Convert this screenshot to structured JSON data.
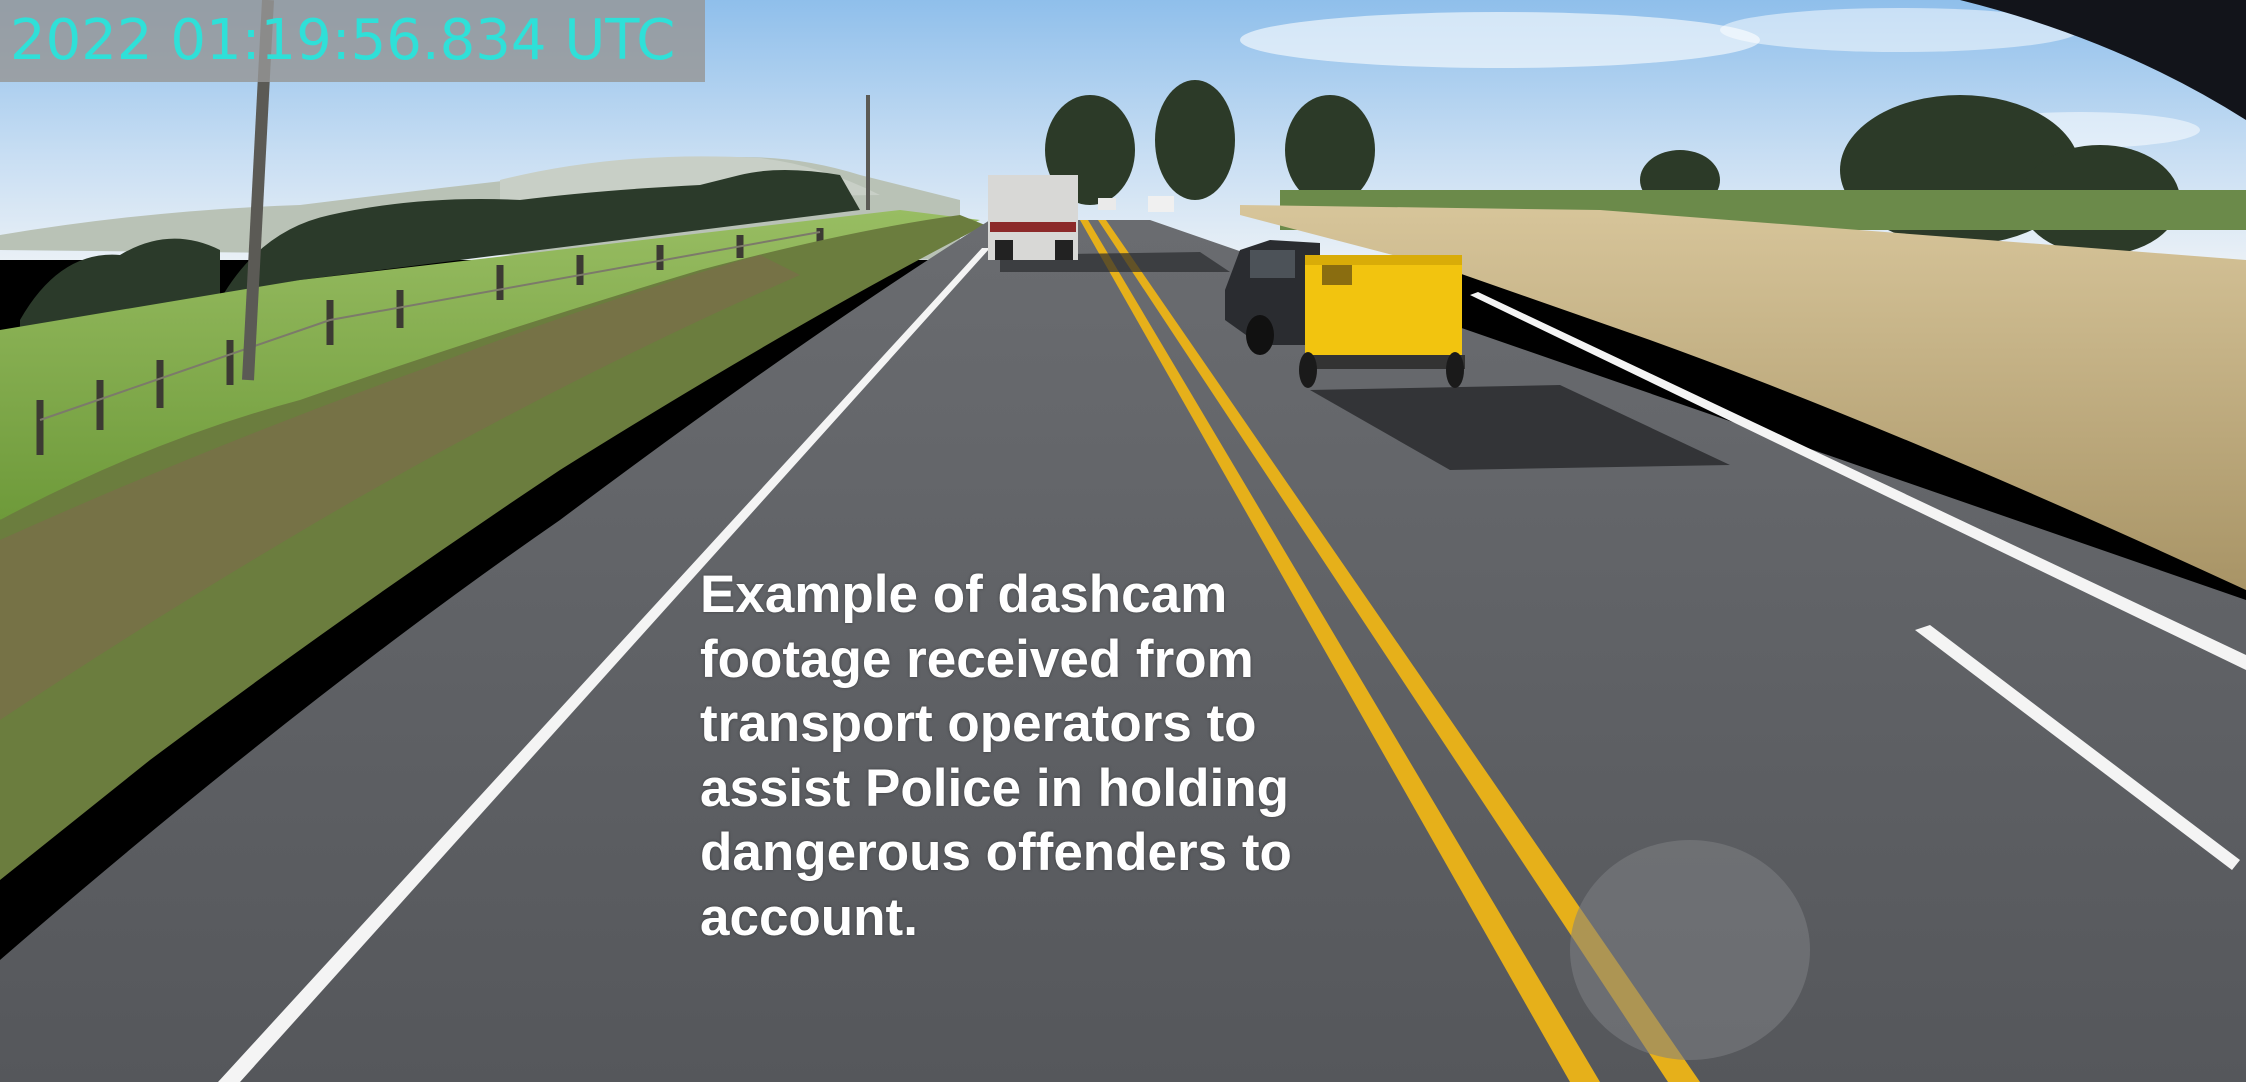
{
  "overlay": {
    "timestamp": "2022 01:19:56.834 UTC",
    "caption_lines": [
      "Example of dashcam",
      "footage received from",
      "transport operators to",
      "assist Police in holding",
      "dangerous offenders to",
      "account."
    ]
  },
  "colors": {
    "timestamp_text": "#2fe0d8",
    "timestamp_bg": "#969696",
    "centre_line": "#e8b21a",
    "trailer": "#f2c40f",
    "sky": "#9fc8ef",
    "road": "#5a5c60",
    "grass": "#7faa4a",
    "crop": "#c8b58a"
  },
  "scene": {
    "description_objects": [
      "sky",
      "hills",
      "trees",
      "fence",
      "road",
      "truck",
      "suv",
      "yellow-trailer",
      "crop-field"
    ]
  }
}
